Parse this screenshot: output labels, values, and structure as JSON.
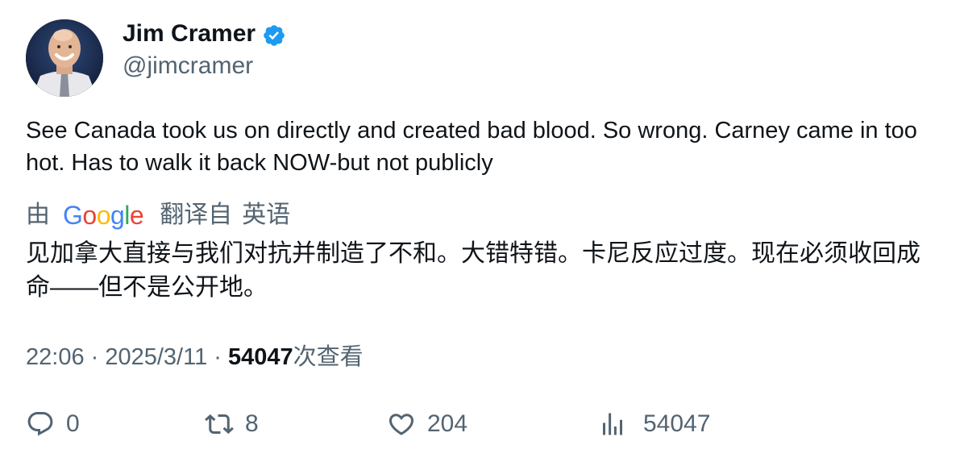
{
  "author": {
    "display_name": "Jim Cramer",
    "handle": "@jimcramer",
    "verified": true,
    "verified_color": "#1d9bf0"
  },
  "tweet": {
    "text": "See Canada took us on directly and created bad blood. So wrong. Carney came in too hot. Has to walk it back NOW-but not publicly"
  },
  "translation": {
    "by_label": "由",
    "provider_letters": [
      {
        "ch": "G",
        "color": "#4285F4"
      },
      {
        "ch": "o",
        "color": "#EA4335"
      },
      {
        "ch": "o",
        "color": "#FBBC05"
      },
      {
        "ch": "g",
        "color": "#4285F4"
      },
      {
        "ch": "l",
        "color": "#34A853"
      },
      {
        "ch": "e",
        "color": "#EA4335"
      }
    ],
    "from_label": "翻译自",
    "language": "英语",
    "text": "见加拿大直接与我们对抗并制造了不和。大错特错。卡尼反应过度。现在必须收回成命——但不是公开地。"
  },
  "meta": {
    "time": "22:06",
    "separator": " · ",
    "date": "2025/3/11",
    "views_count": "54047",
    "views_label": "次查看"
  },
  "actions": {
    "reply_count": "0",
    "retweet_count": "8",
    "like_count": "204",
    "views_count": "54047"
  },
  "colors": {
    "text_primary": "#0f1419",
    "text_secondary": "#536471"
  }
}
